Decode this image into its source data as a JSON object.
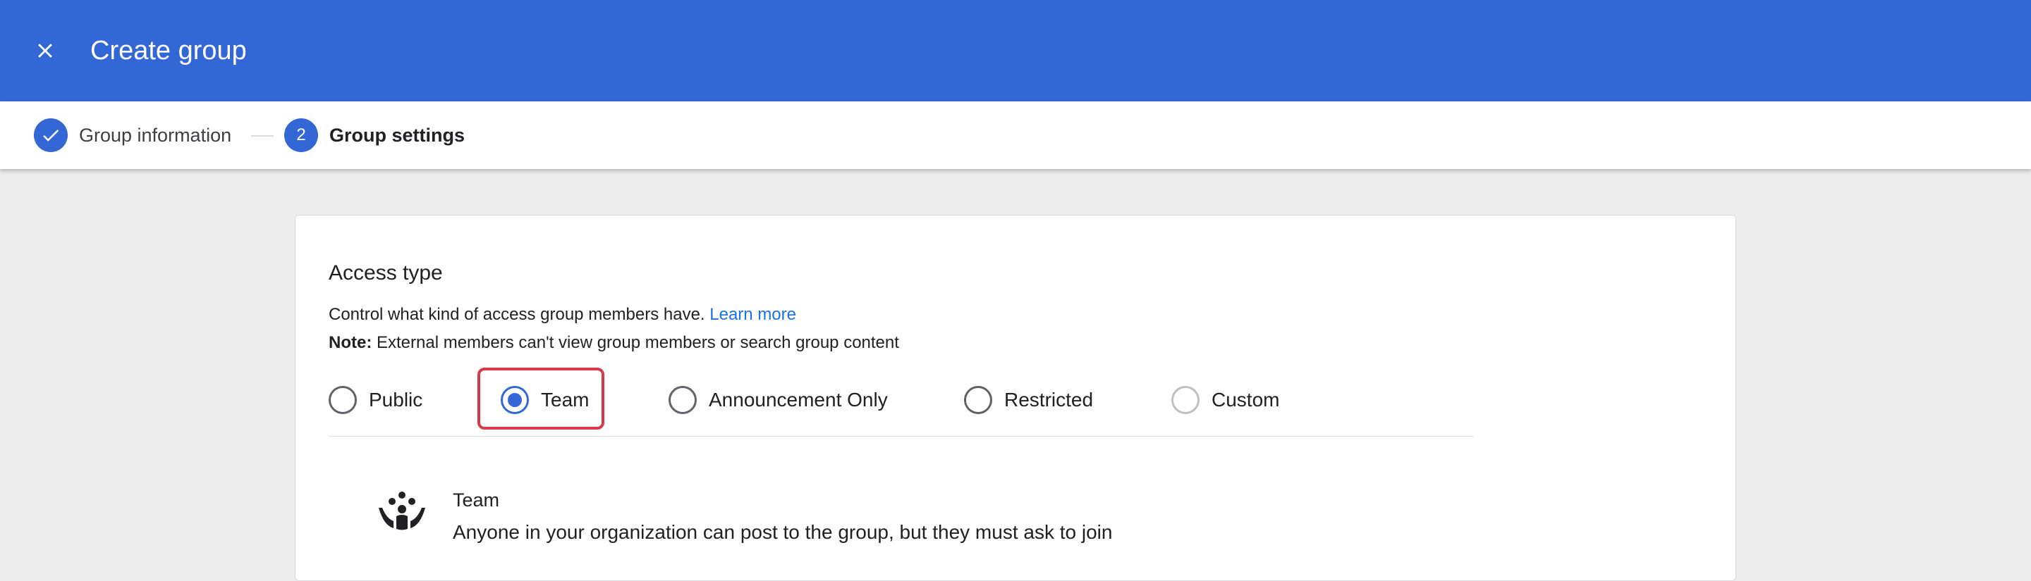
{
  "header": {
    "title": "Create group",
    "close_icon": "close-icon",
    "background": "#3367d6"
  },
  "stepper": {
    "steps": [
      {
        "label": "Group information",
        "state": "completed",
        "marker": "✓",
        "icon": "check-icon"
      },
      {
        "label": "Group settings",
        "state": "active",
        "marker": "2"
      }
    ]
  },
  "access": {
    "title": "Access type",
    "description": "Control what kind of access group members have.",
    "learn_more": "Learn more",
    "note_label": "Note:",
    "note_text": "External members can't view group members or search group content",
    "options": [
      {
        "label": "Public",
        "checked": false
      },
      {
        "label": "Team",
        "checked": true
      },
      {
        "label": "Announcement Only",
        "checked": false
      },
      {
        "label": "Restricted",
        "checked": false
      },
      {
        "label": "Custom",
        "checked": false
      }
    ],
    "highlight_color": "#d93a4a",
    "selected": {
      "icon": "team-people-icon",
      "title": "Team",
      "description": "Anyone in your organization can post to the group, but they must ask to join"
    }
  }
}
